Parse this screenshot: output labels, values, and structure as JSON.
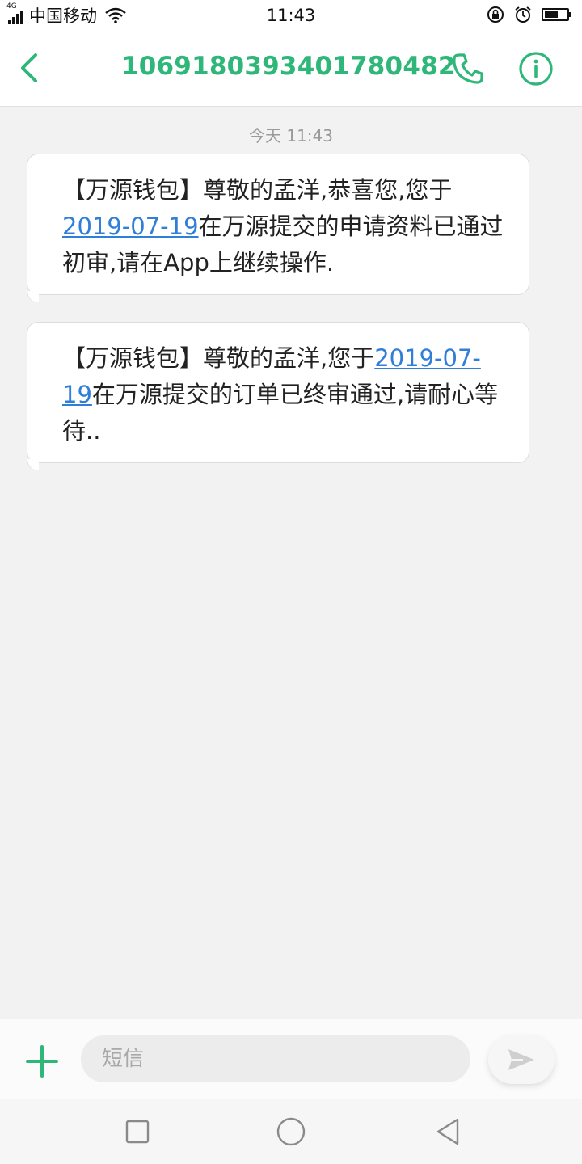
{
  "status_bar": {
    "network": "4G",
    "carrier": "中国移动",
    "time": "11:43",
    "icons": [
      "signal-icon",
      "wifi-icon",
      "rotation-lock-icon",
      "alarm-icon",
      "battery-icon"
    ],
    "battery_level": 0.6
  },
  "header": {
    "title": "1069180393401780482",
    "back_icon": "chevron-left-icon",
    "call_icon": "phone-icon",
    "info_icon": "info-icon"
  },
  "conversation": {
    "timestamp": "今天 11:43",
    "messages": [
      {
        "prefix": "【万源钱包】尊敬的孟洋,恭喜您,您于",
        "date": "2019-07-19",
        "suffix": "在万源提交的申请资料已通过初审,请在App上继续操作."
      },
      {
        "prefix": "【万源钱包】尊敬的孟洋,您于",
        "date": "2019-07-19",
        "suffix": "在万源提交的订单已终审通过,请耐心等待.."
      }
    ]
  },
  "input_bar": {
    "placeholder": "短信",
    "value": "",
    "add_icon": "plus-icon",
    "send_icon": "send-icon"
  },
  "nav_bar": {
    "icons": [
      "recent-apps-icon",
      "home-icon",
      "back-icon"
    ]
  },
  "colors": {
    "accent": "#2fb77a",
    "link": "#2f7fd8",
    "background": "#f2f2f2"
  }
}
